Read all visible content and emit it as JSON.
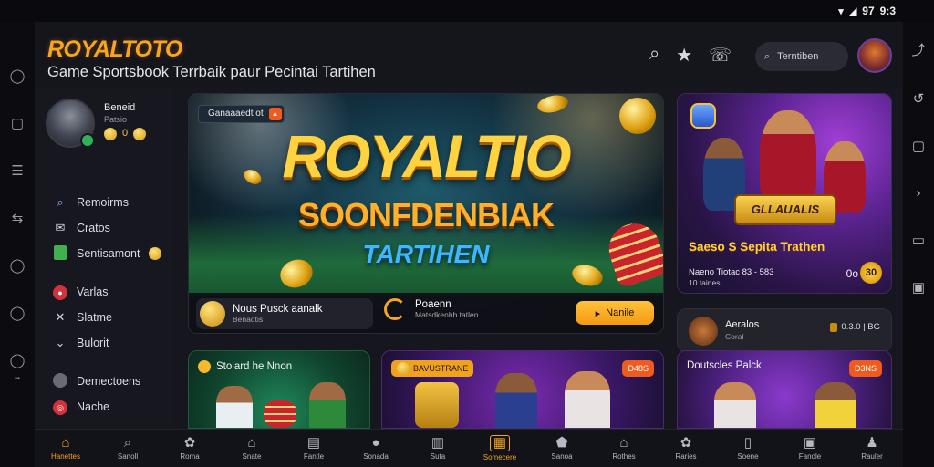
{
  "status_bar": {
    "time": "9:3",
    "wifi_icon": "wifi-icon",
    "signal_icon": "signal-icon",
    "battery": "97"
  },
  "header": {
    "logo": "ROYALTOTO",
    "tagline": "Game Sportsbook Terrbaik paur Pecintai Tartihen",
    "search_placeholder": "Terntiben"
  },
  "profile": {
    "name": "Beneid",
    "sub": "Patsio",
    "coin_value": "0"
  },
  "sidebar": {
    "items": [
      {
        "label": "Remoirms",
        "icon": "search-icon"
      },
      {
        "label": "Cratos",
        "icon": "mail-icon"
      },
      {
        "label": "Sentisamont",
        "icon": "document-icon"
      },
      {
        "label": "Varlas",
        "icon": "record-icon"
      },
      {
        "label": "Slatme",
        "icon": "close-icon"
      },
      {
        "label": "Bulorit",
        "icon": "chevron-down-icon"
      },
      {
        "label": "Demectoens",
        "icon": "circle-icon"
      },
      {
        "label": "Nache",
        "icon": "chip-icon"
      }
    ]
  },
  "hero": {
    "chip_label": "Ganaaaedt ot",
    "title": "ROYALTIO",
    "subtitle": "SOONFDENBIAK",
    "subtitle2": "TARTIHEN",
    "bar": {
      "left_title": "Nous Pusck aanalk",
      "left_sub": "Benadtis",
      "mid_title": "Poaenn",
      "mid_sub": "Matsdkenhb tatlen",
      "button": "Nanile"
    }
  },
  "promo": {
    "shield_text": "GLLAUALIS",
    "title": "Saeso S Sepita Trathen",
    "line1": "Naeno  Tiotac  83 - 583",
    "line2": "10 taines",
    "value": "0o",
    "circle_value": "30"
  },
  "mini_card": {
    "title": "Aeralos",
    "sub": "Coral",
    "right": "0.3.0 | BG"
  },
  "cards": [
    {
      "title": "Stolard he Nnon"
    },
    {
      "chip": "BAVUSTRANE",
      "pill": "D48S"
    },
    {
      "title": "Doutscles Palck",
      "pill": "D3NS"
    }
  ],
  "bottom_nav": [
    {
      "label": "Hanettes",
      "icon": "home-icon",
      "active": true
    },
    {
      "label": "Sanoll",
      "icon": "search-icon"
    },
    {
      "label": "Roma",
      "icon": "ball-icon"
    },
    {
      "label": "Snate",
      "icon": "home-icon"
    },
    {
      "label": "Fantle",
      "icon": "list-icon"
    },
    {
      "label": "Sonada",
      "icon": "chat-icon"
    },
    {
      "label": "Suta",
      "icon": "ticket-icon"
    },
    {
      "label": "Somecere",
      "icon": "layout-icon",
      "active_box": true
    },
    {
      "label": "Sanoa",
      "icon": "shield-icon"
    },
    {
      "label": "Rothes",
      "icon": "home-icon"
    },
    {
      "label": "Raries",
      "icon": "ball-icon"
    },
    {
      "label": "Soene",
      "icon": "phone-icon"
    },
    {
      "label": "Fanole",
      "icon": "save-icon"
    },
    {
      "label": "Rauler",
      "icon": "trophy-icon"
    }
  ],
  "colors": {
    "accent": "#f6a51c",
    "background": "#16161e",
    "button": "#ffc23a"
  }
}
